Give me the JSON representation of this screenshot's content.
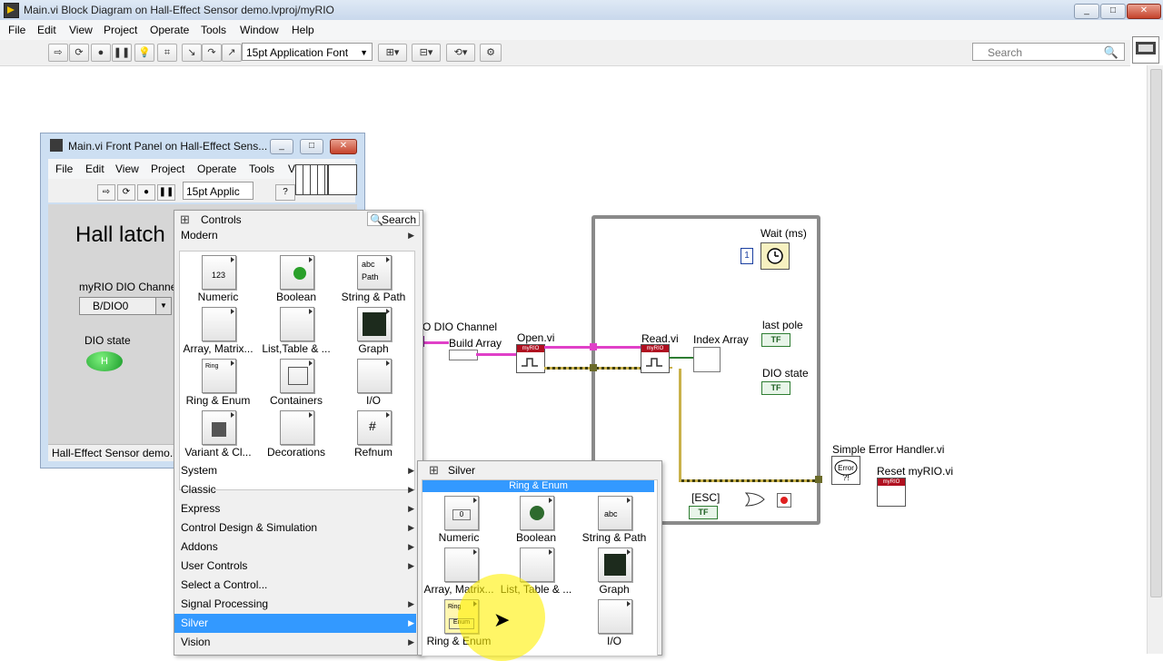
{
  "window": {
    "title": "Main.vi Block Diagram on Hall-Effect Sensor demo.lvproj/myRIO",
    "controls": {
      "minimize": "▭",
      "maximize": "▭",
      "close": "✕"
    }
  },
  "menubar": [
    "File",
    "Edit",
    "View",
    "Project",
    "Operate",
    "Tools",
    "Window",
    "Help"
  ],
  "toolbar": {
    "font_select": "15pt Application Font",
    "search_placeholder": "Search"
  },
  "front_panel": {
    "title": "Main.vi Front Panel on Hall-Effect Sens...",
    "menubar": [
      "File",
      "Edit",
      "View",
      "Project",
      "Operate",
      "Tools",
      "V"
    ],
    "font_select": "15pt Applic",
    "heading": "Hall latch",
    "channel_label": "myRIO DIO Channe",
    "channel_value": "B/DIO0",
    "dio_state_label": "DIO state",
    "led_text": "H",
    "status_text": "Hall-Effect Sensor demo.l"
  },
  "palette": {
    "title": "Controls",
    "search_label": "Search",
    "header_item": "Modern",
    "grid": [
      {
        "label": "Numeric",
        "icon": "numeric-icon"
      },
      {
        "label": "Boolean",
        "icon": "boolean-icon"
      },
      {
        "label": "String & Path",
        "icon": "string-path-icon"
      },
      {
        "label": "Array, Matrix...",
        "icon": "array-matrix-icon"
      },
      {
        "label": "List,Table & ...",
        "icon": "list-table-icon"
      },
      {
        "label": "Graph",
        "icon": "graph-icon"
      },
      {
        "label": "Ring & Enum",
        "icon": "ring-enum-icon"
      },
      {
        "label": "Containers",
        "icon": "containers-icon"
      },
      {
        "label": "I/O",
        "icon": "io-icon"
      },
      {
        "label": "Variant & Cl...",
        "icon": "variant-class-icon"
      },
      {
        "label": "Decorations",
        "icon": "decorations-icon"
      },
      {
        "label": "Refnum",
        "icon": "refnum-icon"
      }
    ],
    "categories": [
      "System",
      "Classic",
      "Express",
      "Control Design & Simulation",
      "Addons",
      "User Controls",
      "Select a Control...",
      "Signal Processing",
      "Silver",
      "Vision"
    ],
    "selected_category": "Silver"
  },
  "silver_palette": {
    "title": "Silver",
    "highlighted": "Ring & Enum",
    "grid": [
      {
        "label": "Numeric",
        "icon": "silver-numeric-icon"
      },
      {
        "label": "Boolean",
        "icon": "silver-boolean-icon"
      },
      {
        "label": "String & Path",
        "icon": "silver-string-icon"
      },
      {
        "label": "Array, Matrix...",
        "icon": "silver-array-icon"
      },
      {
        "label": "List, Table & ...",
        "icon": "silver-list-icon"
      },
      {
        "label": "Graph",
        "icon": "silver-graph-icon"
      },
      {
        "label": "Ring & Enum",
        "icon": "silver-ring-enum-icon"
      },
      {
        "label": "I/O",
        "icon": "silver-io-icon"
      }
    ]
  },
  "block_diagram": {
    "dio_channel_label": "O DIO Channel",
    "build_array": "Build Array",
    "open_vi": "Open.vi",
    "read_vi": "Read.vi",
    "index_array": "Index Array",
    "wait": "Wait (ms)",
    "wait_constant": "1",
    "last_pole": "last pole",
    "dio_state": "DIO state",
    "esc": "[ESC]",
    "simple_error_handler": "Simple Error Handler.vi",
    "reset_myrio": "Reset myRIO.vi",
    "myrio_header": "myRIO",
    "tf": "TF"
  }
}
